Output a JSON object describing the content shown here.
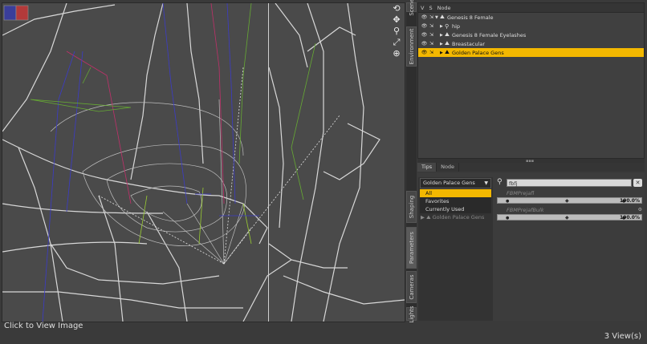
{
  "status": {
    "left": "Click to View Image",
    "right": "3 View(s)"
  },
  "viewport": {
    "tools": [
      "rotate-icon",
      "move-icon",
      "zoom-icon",
      "frame-icon",
      "orbit-icon"
    ],
    "cube_colors": [
      "#3a3e9a",
      "#b33a3a"
    ]
  },
  "side_tabs": [
    "Scene",
    "Environment",
    "Shaping",
    "Parameters",
    "Cameras",
    "Lights"
  ],
  "scene": {
    "headers": [
      "V",
      "S",
      "Node"
    ],
    "nodes": [
      {
        "label": "Genesis 8 Female",
        "indent": 0,
        "selected": false,
        "expanded": true
      },
      {
        "label": "hip",
        "indent": 1,
        "selected": false,
        "expanded": false
      },
      {
        "label": "Genesis 8 Female Eyelashes",
        "indent": 1,
        "selected": false,
        "expanded": false
      },
      {
        "label": "Breastacular",
        "indent": 1,
        "selected": false,
        "expanded": false
      },
      {
        "label": "Golden Palace Gens",
        "indent": 1,
        "selected": true,
        "expanded": false
      }
    ]
  },
  "bottom_tabs": [
    "Tips",
    "Node"
  ],
  "params": {
    "dropdown": "Golden Palace Gens",
    "filters": [
      "All",
      "Favorites",
      "Currently Used"
    ],
    "tree_item": "Golden Palace Gens",
    "search": "fbfj",
    "properties": [
      {
        "label": "FBMPrejafl",
        "value": "100.0%"
      },
      {
        "label": "FBMPrejafBulk",
        "value": "100.0%"
      }
    ]
  }
}
